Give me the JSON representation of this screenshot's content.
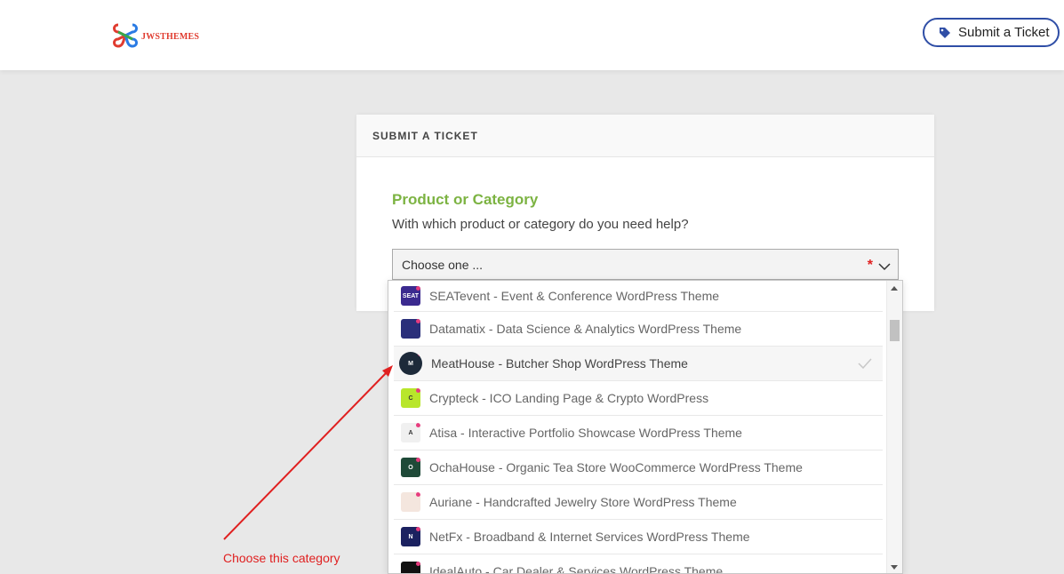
{
  "header": {
    "logo_text": "JWSTHEMES",
    "submit_ticket_label": "Submit a Ticket"
  },
  "card": {
    "title": "SUBMIT A TICKET",
    "field_title": "Product or Category",
    "field_help": "With which product or category do you need help?",
    "select_placeholder": "Choose one ...",
    "required_marker": "*"
  },
  "dropdown": {
    "options": [
      {
        "label": "SEATevent - Event & Conference WordPress Theme",
        "thumb_text": "SEAT",
        "thumb_color": "#3b2a8f"
      },
      {
        "label": "Datamatix - Data Science & Analytics WordPress Theme",
        "thumb_text": "",
        "thumb_color": "#2a2f7a"
      },
      {
        "label": "MeatHouse - Butcher Shop WordPress Theme",
        "thumb_text": "M",
        "thumb_color": "#1d2a3a",
        "selected": true
      },
      {
        "label": "Crypteck - ICO Landing Page & Crypto WordPress",
        "thumb_text": "C",
        "thumb_color": "#b8e62b"
      },
      {
        "label": "Atisa - Interactive Portfolio Showcase WordPress Theme",
        "thumb_text": "A",
        "thumb_color": "#f0f0f0"
      },
      {
        "label": "OchaHouse - Organic Tea Store WooCommerce WordPress Theme",
        "thumb_text": "O",
        "thumb_color": "#1f4a38"
      },
      {
        "label": "Auriane - Handcrafted Jewelry Store WordPress Theme",
        "thumb_text": "",
        "thumb_color": "#f4e6de"
      },
      {
        "label": "NetFx - Broadband & Internet Services WordPress Theme",
        "thumb_text": "N",
        "thumb_color": "#1b2160"
      },
      {
        "label": "IdealAuto - Car Dealer & Services WordPress Theme",
        "thumb_text": "",
        "thumb_color": "#111111"
      }
    ]
  },
  "annotation": {
    "text": "Choose this category"
  },
  "colors": {
    "accent_green": "#7cb342",
    "button_border": "#2f4ea6",
    "annotation_red": "#e02020"
  }
}
